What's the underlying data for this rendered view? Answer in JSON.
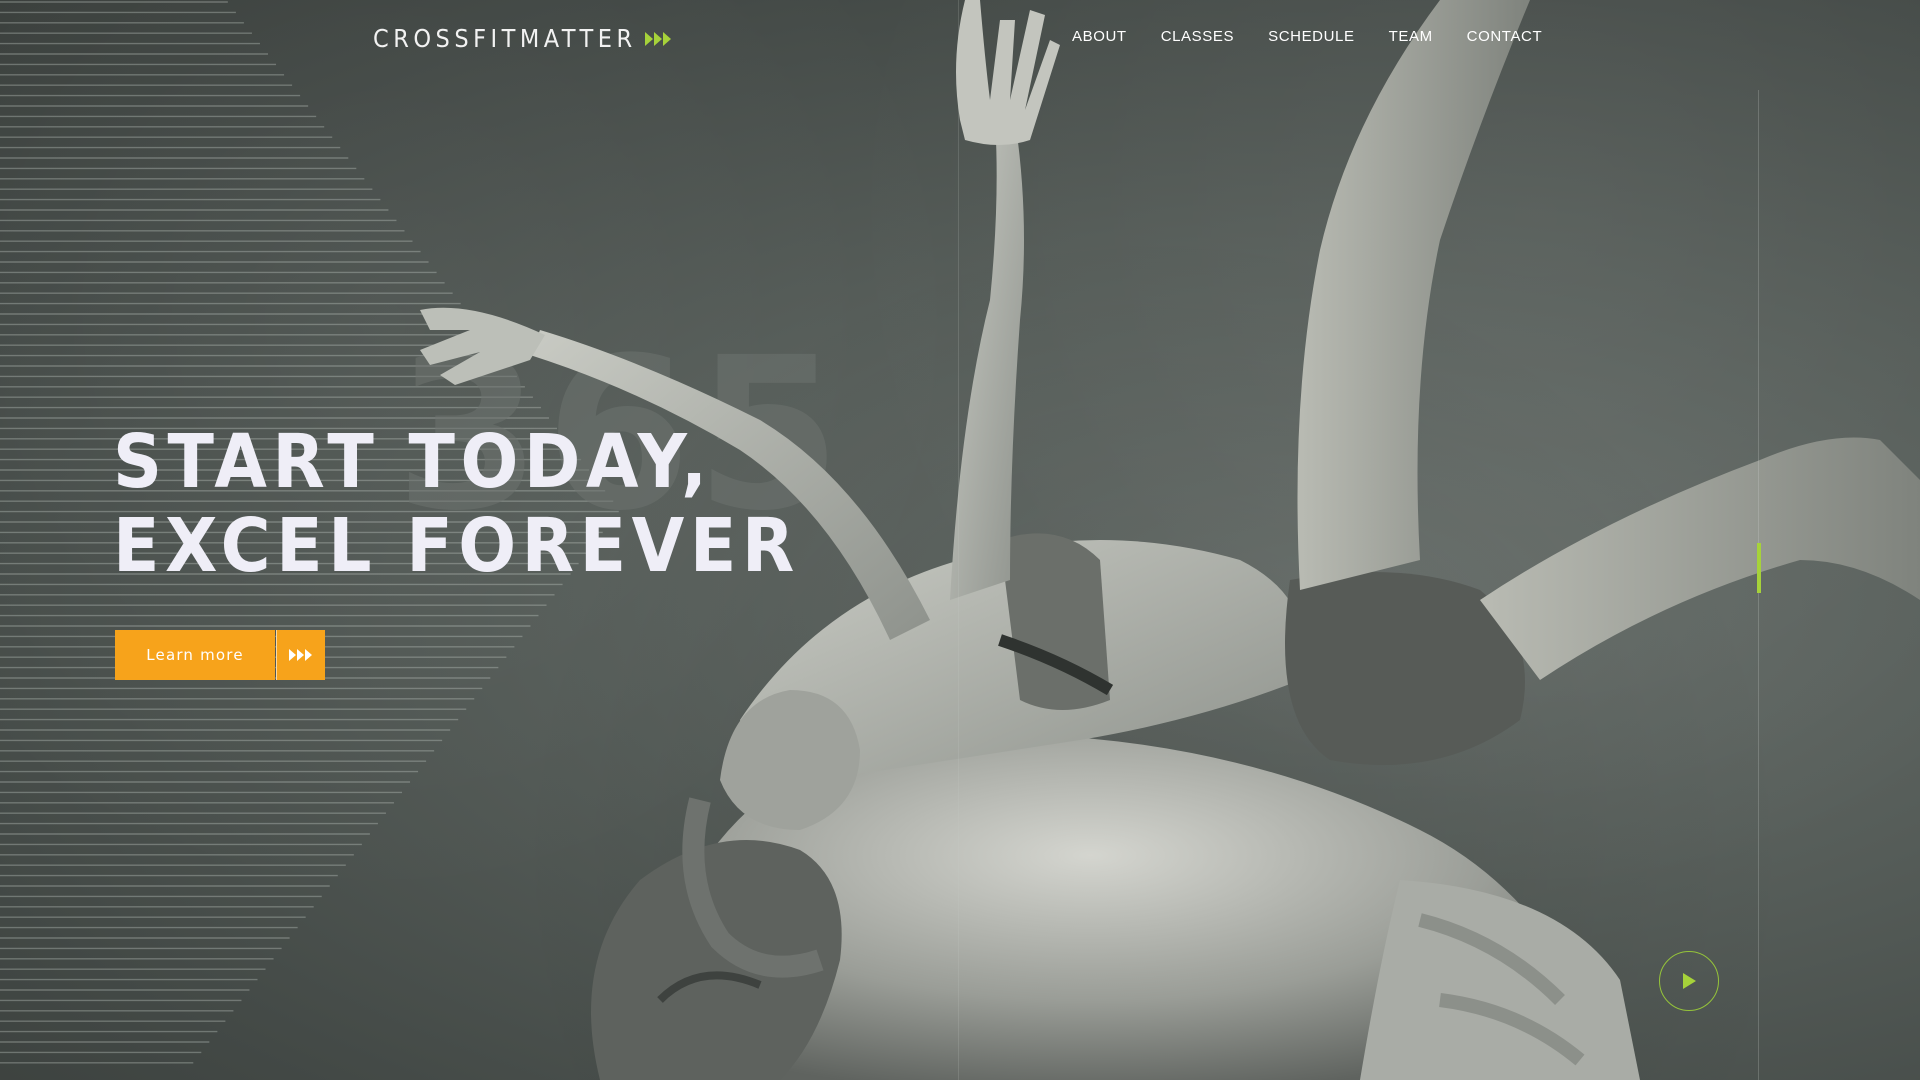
{
  "brand": {
    "name": "CROSSFITMATTER",
    "accent_color": "#a6d23a",
    "arrow_icon": "triple-chevron-right-icon"
  },
  "nav": {
    "items": [
      {
        "label": "ABOUT"
      },
      {
        "label": "CLASSES"
      },
      {
        "label": "SCHEDULE"
      },
      {
        "label": "TEAM"
      },
      {
        "label": "CONTACT"
      }
    ]
  },
  "hero": {
    "headline_line1": "START TODAY,",
    "headline_line2": "EXCEL FOREVER",
    "watermark": "365",
    "cta_label": "Learn more",
    "cta_color": "#f7a31b",
    "play_icon": "play-icon",
    "image_subject": "acrobatic-pair-photo"
  },
  "slider": {
    "indicator_color": "#a6d23a"
  }
}
